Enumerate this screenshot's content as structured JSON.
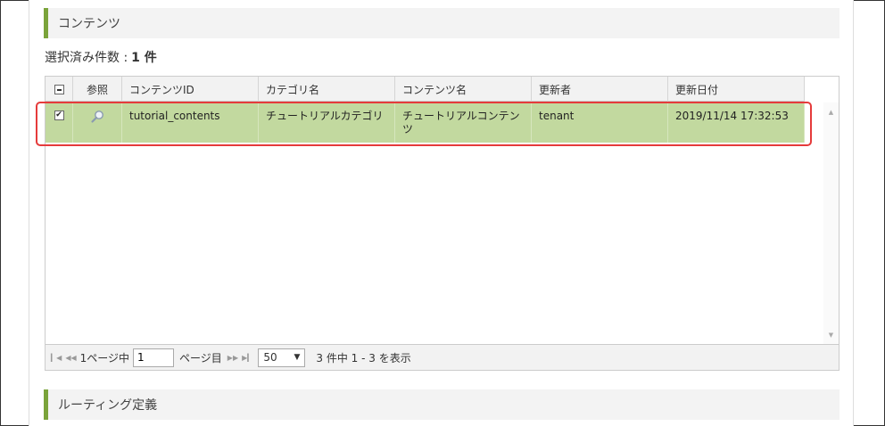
{
  "sections": {
    "contents_title": "コンテンツ",
    "routing_title": "ルーティング定義"
  },
  "selection": {
    "label": "選択済み件数 :",
    "count": "1 件"
  },
  "grid": {
    "columns": [
      "参照",
      "コンテンツID",
      "カテゴリ名",
      "コンテンツ名",
      "更新者",
      "更新日付"
    ],
    "rows": [
      {
        "checked": true,
        "content_id": "tutorial_contents",
        "category_name": "チュートリアルカテゴリ",
        "content_name": "チュートリアルコンテンツ",
        "updated_by": "tenant",
        "updated_at": "2019/11/14 17:32:53"
      }
    ]
  },
  "pager": {
    "page_prefix": "1ページ中",
    "page_value": "1",
    "page_suffix": "ページ目",
    "page_size": "50",
    "summary": "3 件中 1 - 3 を表示"
  },
  "colors": {
    "accent": "#7aa33a",
    "selected_row": "#c2d99f",
    "highlight_border": "#e53b3b"
  },
  "icons": {
    "header_checkbox": "minus-checkbox-icon",
    "row_checkbox": "checkbox-checked-icon",
    "reference": "magnifier-icon",
    "pager": [
      "first-page-icon",
      "prev-page-icon",
      "next-page-icon",
      "last-page-icon"
    ]
  }
}
